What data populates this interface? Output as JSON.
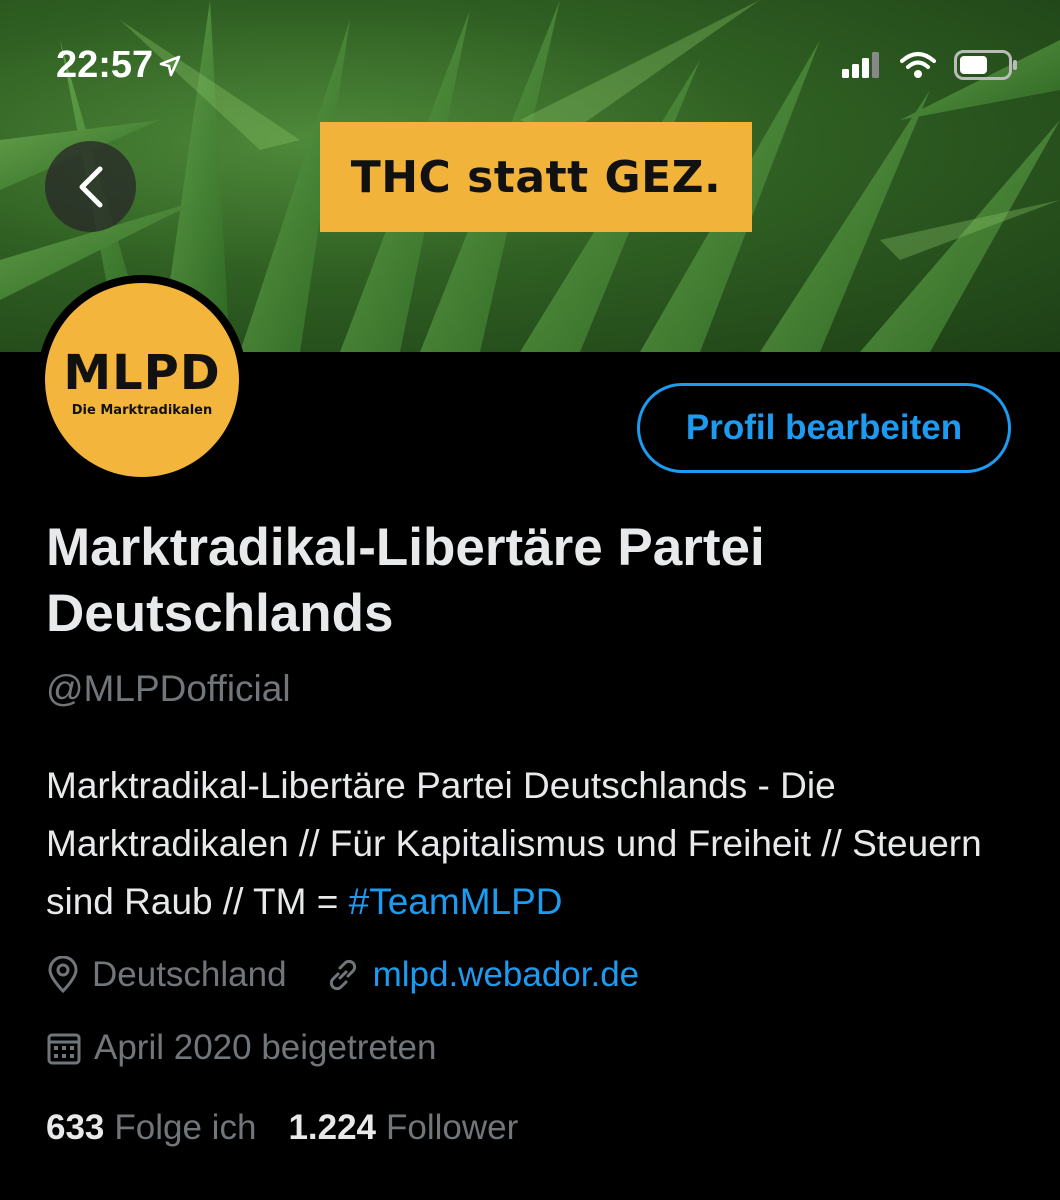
{
  "status_bar": {
    "time": "22:57",
    "icons": [
      "location-arrow-icon",
      "signal-icon",
      "wifi-icon",
      "battery-icon"
    ]
  },
  "banner": {
    "sign_text": "THC statt GEZ.",
    "sign_color": "#f2b33a"
  },
  "avatar": {
    "main": "MLPD",
    "sub": "Die Marktradikalen",
    "color": "#f3b53c"
  },
  "profile": {
    "edit_button": "Profil bearbeiten",
    "display_name": "Marktradikal-Libertäre Partei Deutschlands",
    "handle": "@MLPDofficial",
    "bio_text": "Marktradikal-Libertäre Partei Deutschlands - Die Marktradikalen // Für Kapitalismus und Freiheit // Steuern sind Raub // TM = ",
    "bio_hashtag": "#TeamMLPD",
    "location": "Deutschland",
    "website": "mlpd.webador.de",
    "joined": "April 2020 beigetreten",
    "following_count": "633",
    "following_label": "Folge ich",
    "followers_count": "1.224",
    "followers_label": "Follower"
  },
  "colors": {
    "accent": "#1d9bf0",
    "muted": "#71767b",
    "text": "#e7e9ea",
    "background": "#000000"
  }
}
